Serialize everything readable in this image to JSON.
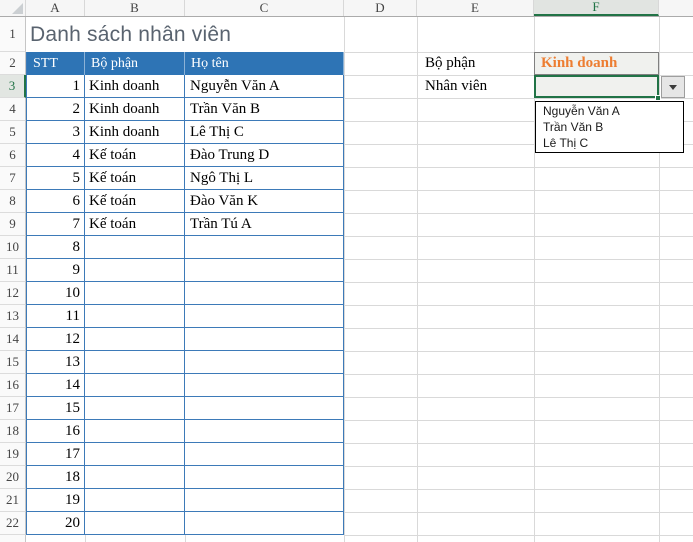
{
  "sheet": {
    "columns": [
      "A",
      "B",
      "C",
      "D",
      "E",
      "F"
    ],
    "rows": [
      1,
      2,
      3,
      4,
      5,
      6,
      7,
      8,
      9,
      10,
      11,
      12,
      13,
      14,
      15,
      16,
      17,
      18,
      19,
      20,
      21,
      22
    ]
  },
  "title": {
    "text": "Danh sách nhân viên"
  },
  "table": {
    "headers": {
      "stt": "STT",
      "dept": "Bộ phận",
      "name": "Họ tên"
    },
    "rows": [
      {
        "stt": "1",
        "dept": "Kinh doanh",
        "name": "Nguyễn Văn A"
      },
      {
        "stt": "2",
        "dept": "Kinh doanh",
        "name": "Trần Văn B"
      },
      {
        "stt": "3",
        "dept": "Kinh doanh",
        "name": "Lê Thị C"
      },
      {
        "stt": "4",
        "dept": "Kế toán",
        "name": "Đào Trung D"
      },
      {
        "stt": "5",
        "dept": "Kế toán",
        "name": "Ngô Thị L"
      },
      {
        "stt": "6",
        "dept": "Kế toán",
        "name": "Đào Văn K"
      },
      {
        "stt": "7",
        "dept": "Kế toán",
        "name": "Trần Tú A"
      },
      {
        "stt": "8",
        "dept": "",
        "name": ""
      },
      {
        "stt": "9",
        "dept": "",
        "name": ""
      },
      {
        "stt": "10",
        "dept": "",
        "name": ""
      },
      {
        "stt": "11",
        "dept": "",
        "name": ""
      },
      {
        "stt": "12",
        "dept": "",
        "name": ""
      },
      {
        "stt": "13",
        "dept": "",
        "name": ""
      },
      {
        "stt": "14",
        "dept": "",
        "name": ""
      },
      {
        "stt": "15",
        "dept": "",
        "name": ""
      },
      {
        "stt": "16",
        "dept": "",
        "name": ""
      },
      {
        "stt": "17",
        "dept": "",
        "name": ""
      },
      {
        "stt": "18",
        "dept": "",
        "name": ""
      },
      {
        "stt": "19",
        "dept": "",
        "name": ""
      },
      {
        "stt": "20",
        "dept": "",
        "name": ""
      }
    ]
  },
  "lookup": {
    "dept_label": "Bộ phận",
    "dept_value": "Kinh doanh",
    "employee_label": "Nhân viên",
    "employee_value": ""
  },
  "dropdown": {
    "items": [
      "Nguyễn Văn A",
      "Trần Văn B",
      "Lê Thị C"
    ]
  },
  "colors": {
    "table_header_blue": "#2E74B5",
    "accent_orange": "#ED7D31",
    "selection_green": "#217346",
    "title_gray": "#59636F"
  }
}
